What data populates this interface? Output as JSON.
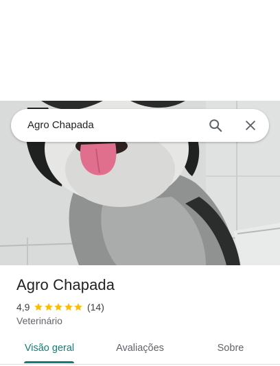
{
  "search": {
    "query": "Agro Chapada"
  },
  "icons": {
    "search": "search-icon",
    "close": "close-icon",
    "star": "star-icon"
  },
  "place": {
    "name": "Agro Chapada",
    "rating": "4,9",
    "stars": 5,
    "review_count": "(14)",
    "category": "Veterinário"
  },
  "tabs": [
    {
      "label": "Visão geral",
      "active": true
    },
    {
      "label": "Avaliações",
      "active": false
    },
    {
      "label": "Sobre",
      "active": false
    }
  ],
  "colors": {
    "accent": "#0f7e7a",
    "star": "#fbbc04",
    "text": "#202124",
    "muted": "#5f6368"
  }
}
